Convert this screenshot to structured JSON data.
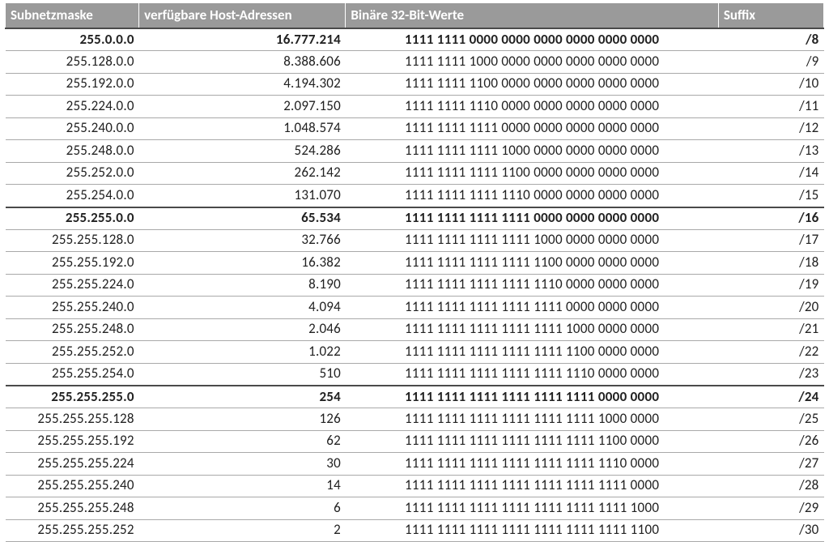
{
  "chart_data": {
    "type": "table",
    "title": "",
    "columns": [
      "Subnetzmaske",
      "verfügbare Host-Adressen",
      "Binäre 32-Bit-Werte",
      "Suffix"
    ],
    "rows": [
      {
        "mask": "255.0.0.0",
        "hosts": "16.777.214",
        "binary": "1111 1111 0000 0000 0000 0000 0000 0000",
        "suffix": "/8",
        "bold": true,
        "sep": false
      },
      {
        "mask": "255.128.0.0",
        "hosts": "8.388.606",
        "binary": "1111 1111 1000 0000 0000 0000 0000 0000",
        "suffix": "/9",
        "bold": false,
        "sep": false
      },
      {
        "mask": "255.192.0.0",
        "hosts": "4.194.302",
        "binary": "1111 1111 1100 0000 0000 0000 0000 0000",
        "suffix": "/10",
        "bold": false,
        "sep": false
      },
      {
        "mask": "255.224.0.0",
        "hosts": "2.097.150",
        "binary": "1111 1111 1110 0000 0000 0000 0000 0000",
        "suffix": "/11",
        "bold": false,
        "sep": false
      },
      {
        "mask": "255.240.0.0",
        "hosts": "1.048.574",
        "binary": "1111 1111 1111 0000 0000 0000 0000 0000",
        "suffix": "/12",
        "bold": false,
        "sep": false
      },
      {
        "mask": "255.248.0.0",
        "hosts": "524.286",
        "binary": "1111 1111 1111 1000 0000 0000 0000 0000",
        "suffix": "/13",
        "bold": false,
        "sep": false
      },
      {
        "mask": "255.252.0.0",
        "hosts": "262.142",
        "binary": "1111 1111 1111 1100 0000 0000 0000 0000",
        "suffix": "/14",
        "bold": false,
        "sep": false
      },
      {
        "mask": "255.254.0.0",
        "hosts": "131.070",
        "binary": "1111 1111 1111 1110 0000 0000 0000 0000",
        "suffix": "/15",
        "bold": false,
        "sep": true
      },
      {
        "mask": "255.255.0.0",
        "hosts": "65.534",
        "binary": "1111 1111 1111 1111 0000 0000 0000 0000",
        "suffix": "/16",
        "bold": true,
        "sep": false
      },
      {
        "mask": "255.255.128.0",
        "hosts": "32.766",
        "binary": "1111 1111 1111 1111 1000 0000 0000 0000",
        "suffix": "/17",
        "bold": false,
        "sep": false
      },
      {
        "mask": "255.255.192.0",
        "hosts": "16.382",
        "binary": "1111 1111 1111 1111 1100 0000 0000 0000",
        "suffix": "/18",
        "bold": false,
        "sep": false
      },
      {
        "mask": "255.255.224.0",
        "hosts": "8.190",
        "binary": "1111 1111 1111 1111 1110 0000 0000 0000",
        "suffix": "/19",
        "bold": false,
        "sep": false
      },
      {
        "mask": "255.255.240.0",
        "hosts": "4.094",
        "binary": "1111 1111 1111 1111 1111 0000 0000 0000",
        "suffix": "/20",
        "bold": false,
        "sep": false
      },
      {
        "mask": "255.255.248.0",
        "hosts": "2.046",
        "binary": "1111 1111 1111 1111 1111 1000 0000 0000",
        "suffix": "/21",
        "bold": false,
        "sep": false
      },
      {
        "mask": "255.255.252.0",
        "hosts": "1.022",
        "binary": "1111 1111 1111 1111 1111 1100 0000 0000",
        "suffix": "/22",
        "bold": false,
        "sep": false
      },
      {
        "mask": "255.255.254.0",
        "hosts": "510",
        "binary": "1111 1111 1111 1111 1111 1110 0000 0000",
        "suffix": "/23",
        "bold": false,
        "sep": true
      },
      {
        "mask": "255.255.255.0",
        "hosts": "254",
        "binary": "1111 1111 1111 1111 1111 1111 0000 0000",
        "suffix": "/24",
        "bold": true,
        "sep": false
      },
      {
        "mask": "255.255.255.128",
        "hosts": "126",
        "binary": "1111 1111 1111 1111 1111 1111 1000 0000",
        "suffix": "/25",
        "bold": false,
        "sep": false
      },
      {
        "mask": "255.255.255.192",
        "hosts": "62",
        "binary": "1111 1111 1111 1111 1111 1111 1100 0000",
        "suffix": "/26",
        "bold": false,
        "sep": false
      },
      {
        "mask": "255.255.255.224",
        "hosts": "30",
        "binary": "1111 1111 1111 1111 1111 1111 1110 0000",
        "suffix": "/27",
        "bold": false,
        "sep": false
      },
      {
        "mask": "255.255.255.240",
        "hosts": "14",
        "binary": "1111 1111 1111 1111 1111 1111 1111 0000",
        "suffix": "/28",
        "bold": false,
        "sep": false
      },
      {
        "mask": "255.255.255.248",
        "hosts": "6",
        "binary": "1111 1111 1111 1111 1111 1111 1111 1000",
        "suffix": "/29",
        "bold": false,
        "sep": false
      },
      {
        "mask": "255.255.255.252",
        "hosts": "2",
        "binary": "1111 1111 1111 1111 1111 1111 1111 1100",
        "suffix": "/30",
        "bold": false,
        "sep": false
      }
    ]
  }
}
